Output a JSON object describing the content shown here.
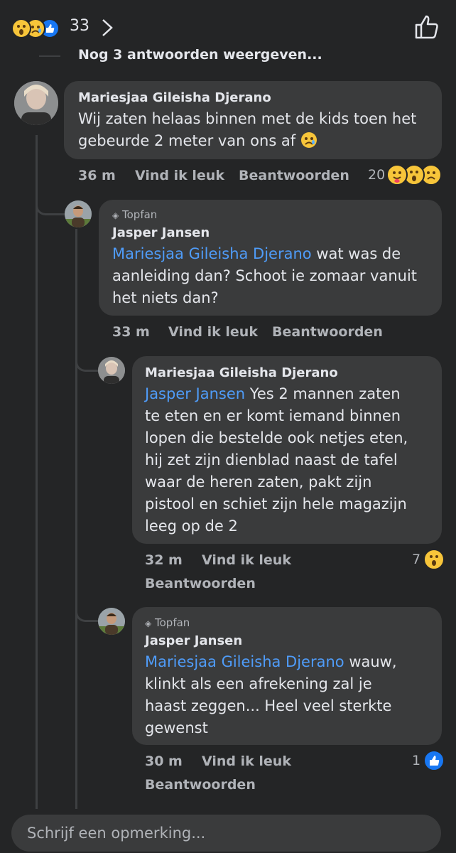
{
  "top_bar": {
    "reaction_count": "33",
    "reaction_icons": [
      "wow-emoji",
      "sad-emoji",
      "like-emoji"
    ]
  },
  "more_replies_label": "Nog 3 antwoorden weergeven...",
  "comments": [
    {
      "author": "Mariesjaa Gileisha Djerano",
      "text_lines": [
        "Wij zaten helaas binnen met de kids toen het",
        "gebeurde 2 meter van ons af"
      ],
      "time": "36 m",
      "like_label": "Vind ik leuk",
      "reply_label": "Beantwoorden",
      "reaction_count": "20"
    },
    {
      "badge": "Topfan",
      "author": "Jasper Jansen",
      "mention": "Mariesjaa Gileisha Djerano",
      "text_after_mention": " wat was de",
      "text_lines": [
        "aanleiding dan? Schoot ie zomaar vanuit",
        "het niets dan?"
      ],
      "time": "33 m",
      "like_label": "Vind ik leuk",
      "reply_label": "Beantwoorden"
    },
    {
      "author": "Mariesjaa Gileisha Djerano",
      "mention": "Jasper Jansen",
      "text_after_mention": " Yes 2 mannen zaten",
      "text_lines": [
        "te eten en er komt iemand binnen",
        "lopen die bestelde ook netjes eten,",
        "hij zet zijn dienblad naast de tafel",
        "waar de heren zaten, pakt zijn",
        "pistool en schiet zijn hele magazijn",
        "leeg op de 2"
      ],
      "time": "32 m",
      "like_label": "Vind ik leuk",
      "reply_label": "Beantwoorden",
      "reaction_count": "7"
    },
    {
      "badge": "Topfan",
      "author": "Jasper Jansen",
      "mention": "Mariesjaa Gileisha Djerano",
      "text_after_mention": " wauw,",
      "text_lines": [
        "klinkt als een afrekening zal je",
        "haast zeggen... Heel veel sterkte",
        "gewenst"
      ],
      "time": "30 m",
      "like_label": "Vind ik leuk",
      "reply_label": "Beantwoorden",
      "reaction_count": "1"
    }
  ],
  "composer": {
    "placeholder": "Schrijf een opmerking..."
  },
  "colors": {
    "background": "#242526",
    "bubble": "#3a3b3c",
    "mention": "#4f9cf9",
    "like": "#1877f2",
    "emoji": "#f7c53a"
  }
}
